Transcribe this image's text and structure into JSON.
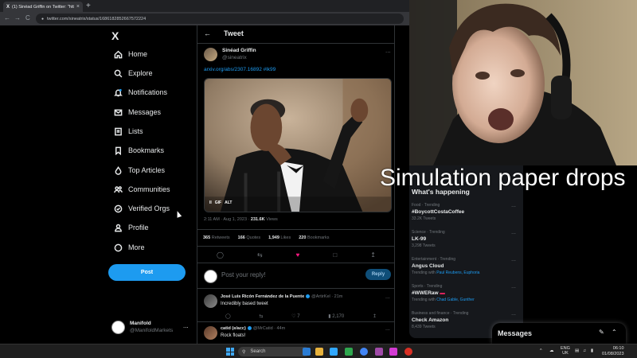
{
  "browser": {
    "tab_title": "(1) Sinéad Griffin on Twitter: \"htt",
    "tab_close": "×",
    "new_tab": "+",
    "url": "twitter.com/sineatrix/status/1686182852667572224",
    "back": "←",
    "forward": "→",
    "reload": "C"
  },
  "nav": {
    "logo": "X",
    "items": [
      {
        "label": "Home",
        "icon": "home-icon"
      },
      {
        "label": "Explore",
        "icon": "search-icon"
      },
      {
        "label": "Notifications",
        "icon": "bell-icon"
      },
      {
        "label": "Messages",
        "icon": "mail-icon"
      },
      {
        "label": "Lists",
        "icon": "list-icon"
      },
      {
        "label": "Bookmarks",
        "icon": "bookmark-icon"
      },
      {
        "label": "Top Articles",
        "icon": "flame-icon"
      },
      {
        "label": "Communities",
        "icon": "people-icon"
      },
      {
        "label": "Verified Orgs",
        "icon": "verified-icon"
      },
      {
        "label": "Profile",
        "icon": "person-icon"
      },
      {
        "label": "More",
        "icon": "more-circle-icon"
      }
    ],
    "post_label": "Post",
    "account": {
      "name": "Manifold",
      "handle": "@ManifoldMarkets",
      "dots": "..."
    }
  },
  "tweet": {
    "header_title": "Tweet",
    "back_arrow": "←",
    "author_name": "Sinéad Griffin",
    "author_handle": "@sineatrix",
    "more": "...",
    "text": "arxiv.org/abs/2307.16892 #lk99",
    "media_badges": [
      "GIF",
      "ALT"
    ],
    "time": "2:11 AM · Aug 1, 2023 · ",
    "views_count": "231.6K",
    "views_label": " Views",
    "retweets": "365",
    "retweets_label": " Retweets",
    "quotes": "166",
    "quotes_label": " Quotes",
    "likes": "1,949",
    "likes_label": " Likes",
    "bookmarks": "220",
    "bookmarks_label": " Bookmarks",
    "reply_placeholder": "Post your reply!",
    "reply_button": "Reply"
  },
  "replies": [
    {
      "name": "José Luis Ricón Fernández de la Puente",
      "handle": "@ArtirKel",
      "time": "· 21m",
      "text": "Incredibly based tweet",
      "likes": "7",
      "views": "2,170"
    },
    {
      "name": "catid (e/acc)",
      "handle": "@MrCatid",
      "time": "· 44m",
      "text": "Rock floats!"
    }
  ],
  "trends": {
    "header": "What's happening",
    "items": [
      {
        "category": "Food · Trending",
        "title": "#BoycottCostaCoffee",
        "count": "33.2K Tweets"
      },
      {
        "category": "Science · Trending",
        "title": "LK-99",
        "count": "3,298 Tweets"
      },
      {
        "category": "Entertainment · Trending",
        "title": "Angus Cloud",
        "count_prefix": "Trending with ",
        "count_links": "Paul Reubens, Euphoria"
      },
      {
        "category": "Sports · Trending",
        "title": "#WWERaw",
        "count_prefix": "Trending with ",
        "count_links": "Chad Gable, Gunther"
      },
      {
        "category": "Business and finance · Trending",
        "title": "Check Amazon",
        "count": "8,439 Tweets"
      }
    ]
  },
  "overlay": {
    "caption": "Simulation paper drops"
  },
  "messages_drawer": {
    "title": "Messages"
  },
  "taskbar": {
    "search_label": "Search",
    "lang_top": "ENG",
    "lang_bottom": "UK",
    "time": "06:10",
    "date": "01/08/2023"
  }
}
